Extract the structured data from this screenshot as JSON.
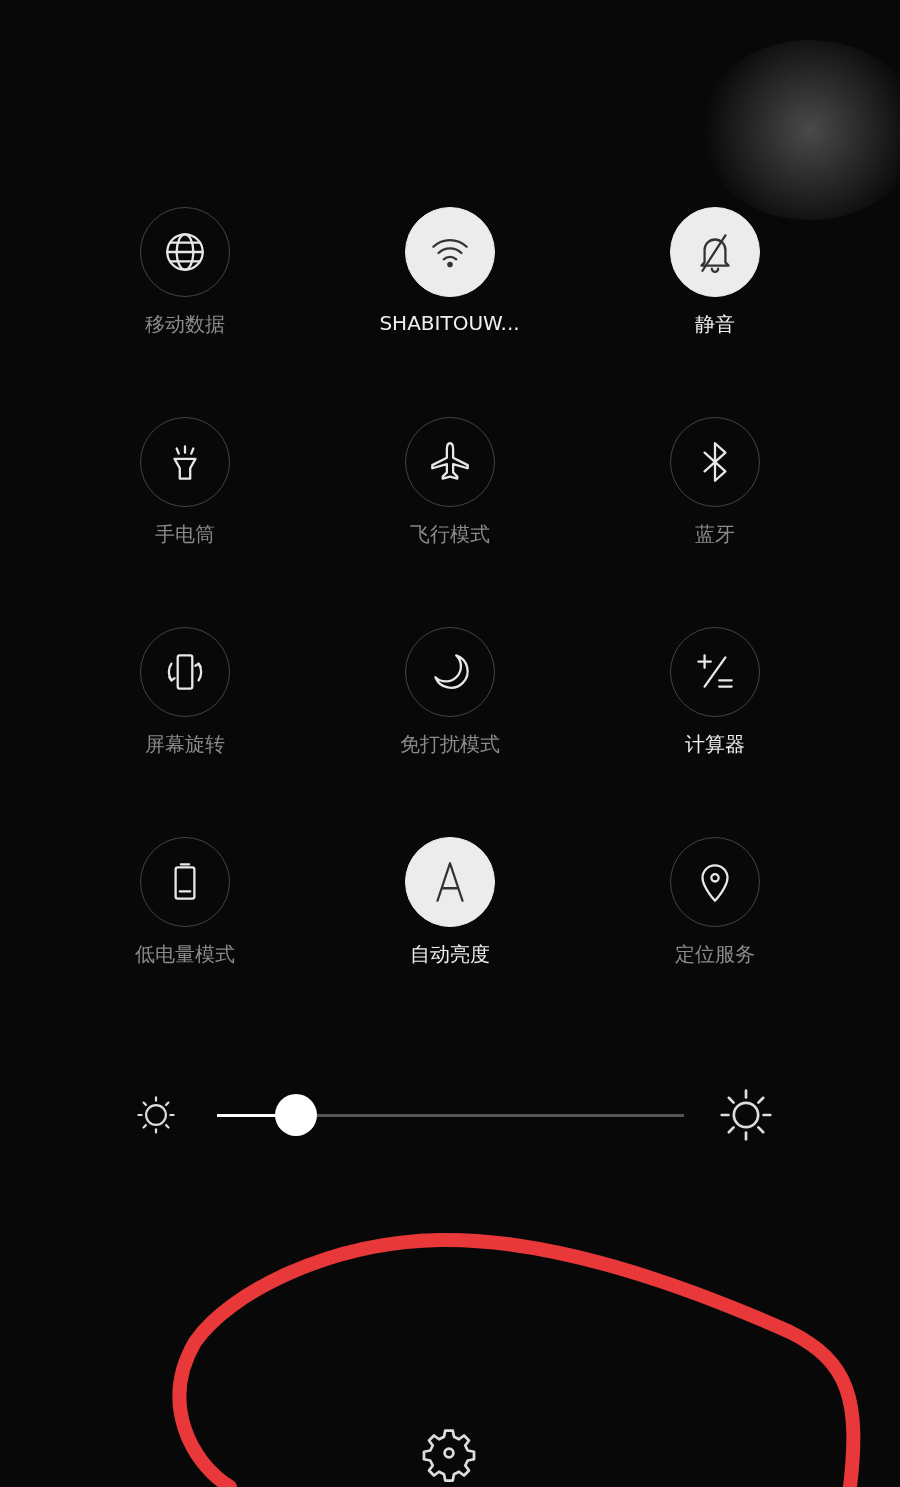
{
  "tiles": [
    {
      "label": "移动数据",
      "kind": "toggle",
      "on": false
    },
    {
      "label": "SHABITOUW...",
      "kind": "toggle",
      "on": true
    },
    {
      "label": "静音",
      "kind": "toggle",
      "on": true
    },
    {
      "label": "手电筒",
      "kind": "toggle",
      "on": false
    },
    {
      "label": "飞行模式",
      "kind": "toggle",
      "on": false
    },
    {
      "label": "蓝牙",
      "kind": "toggle",
      "on": false
    },
    {
      "label": "屏幕旋转",
      "kind": "toggle",
      "on": false
    },
    {
      "label": "免打扰模式",
      "kind": "toggle",
      "on": false
    },
    {
      "label": "计算器",
      "kind": "shortcut"
    },
    {
      "label": "低电量模式",
      "kind": "toggle",
      "on": false
    },
    {
      "label": "自动亮度",
      "kind": "toggle",
      "on": true
    },
    {
      "label": "定位服务",
      "kind": "toggle",
      "on": false
    }
  ],
  "brightness": {
    "level": 0.17
  }
}
